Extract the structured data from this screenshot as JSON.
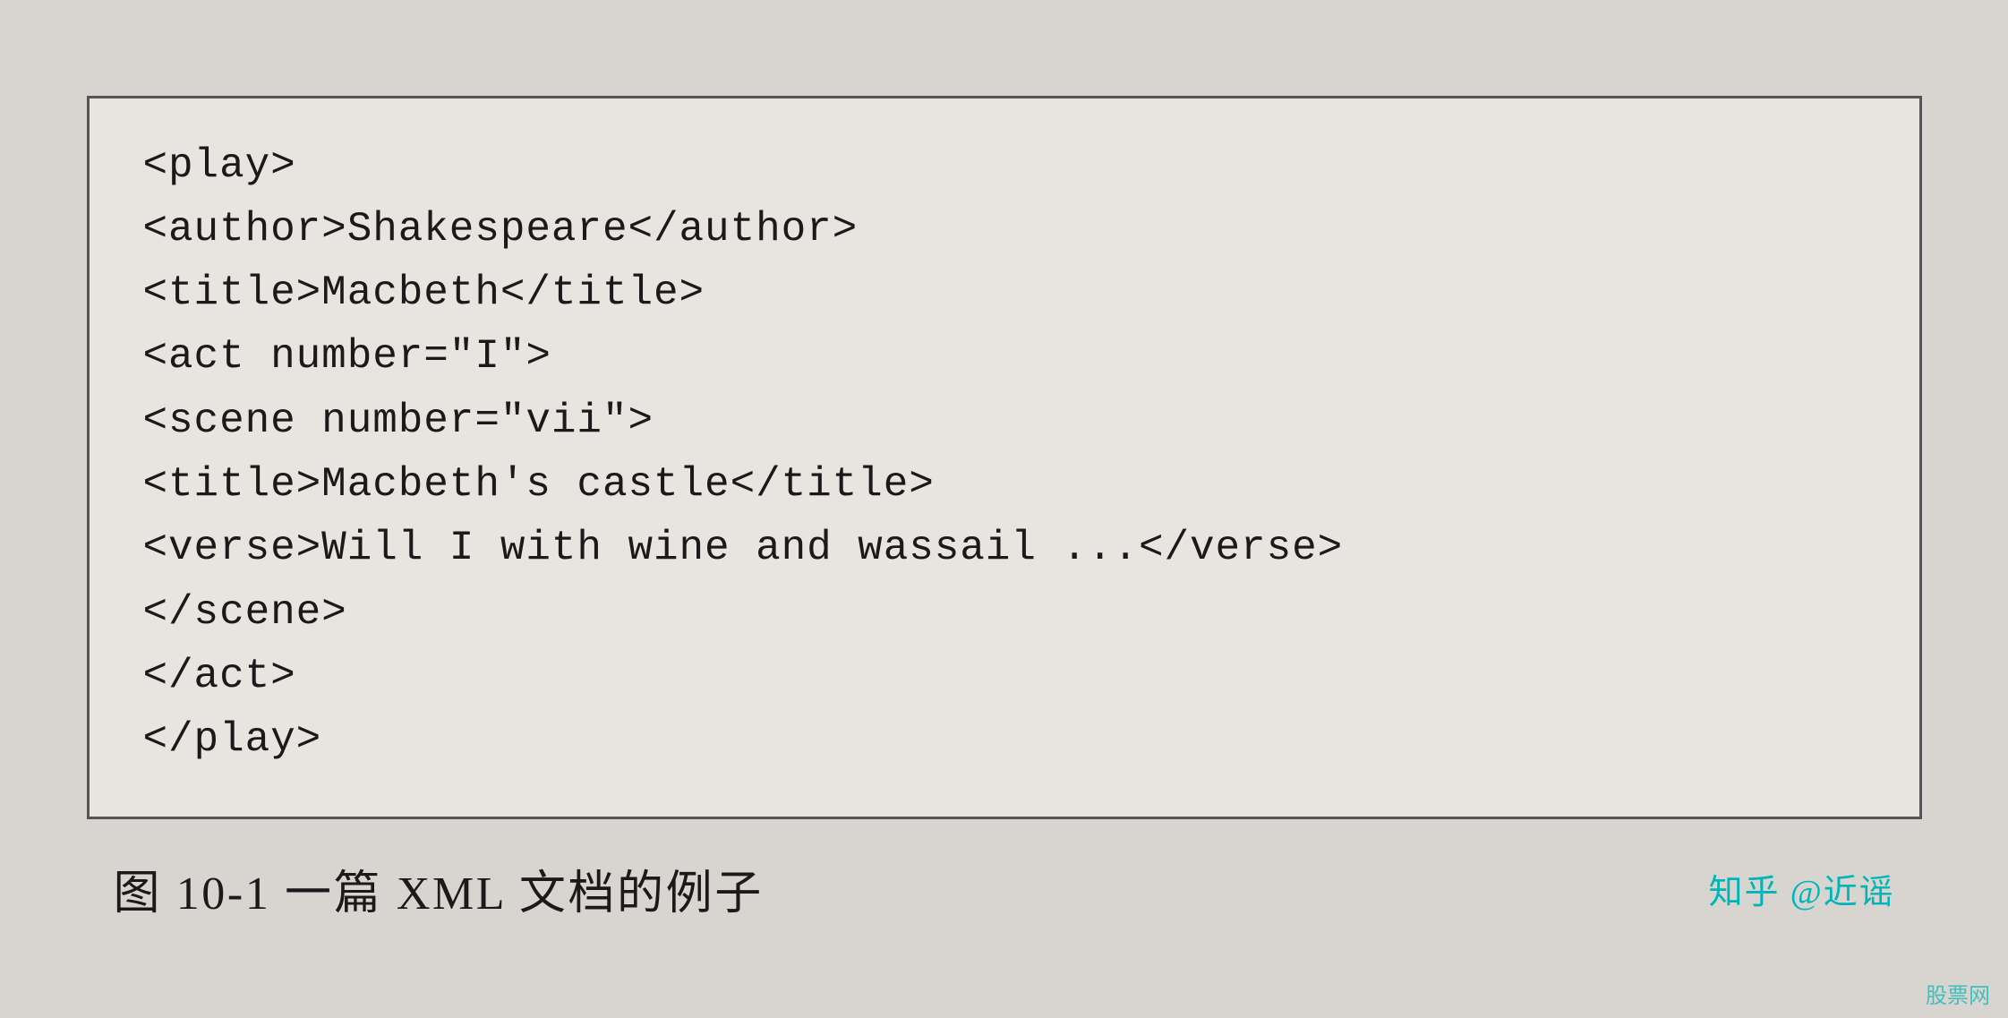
{
  "page": {
    "background_color": "#d8d5d0"
  },
  "codebox": {
    "border_color": "#555555",
    "background_color": "#e8e5e0",
    "lines": [
      "<play>",
      "<author>Shakespeare</author>",
      "<title>Macbeth</title>",
      "<act number=\"I\">",
      "<scene number=\"vii\">",
      "<title>Macbeth's castle</title>",
      "<verse>Will I with wine and wassail ...</verse>",
      "</scene>",
      "</act>",
      "</play>"
    ]
  },
  "caption": {
    "text": "图 10-1    一篇 XML 文档的例子",
    "watermark": "知乎 @近谣",
    "bottom_watermark": "股票网"
  }
}
